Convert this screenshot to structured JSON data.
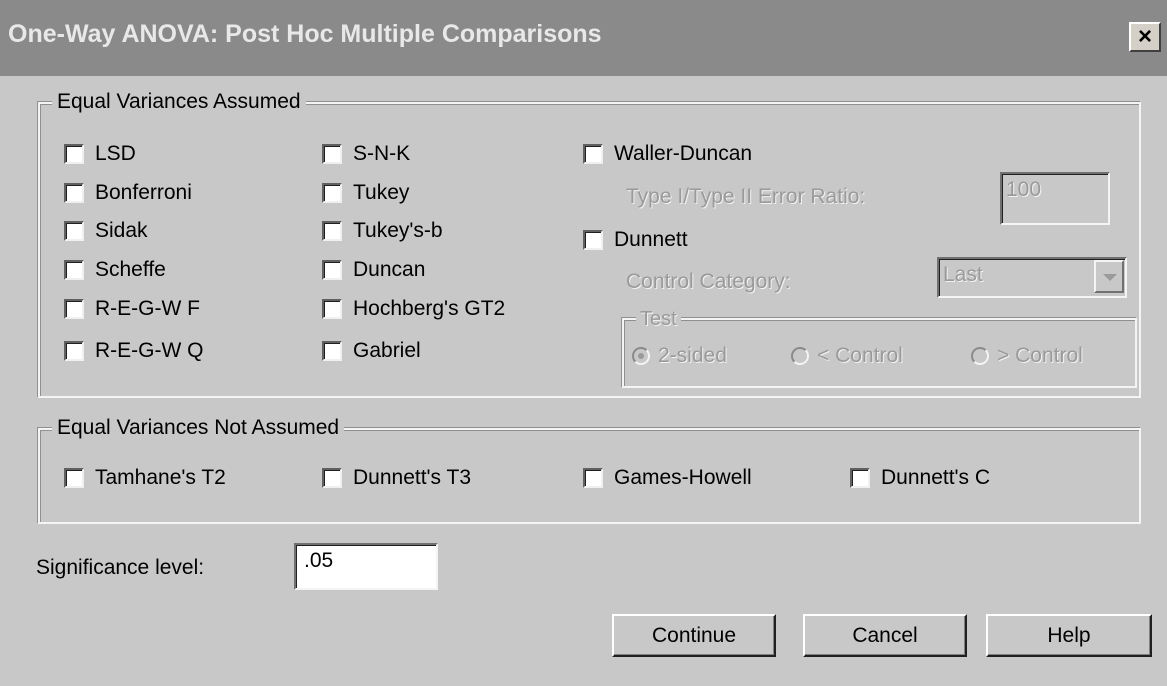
{
  "window": {
    "title": "One-Way ANOVA: Post Hoc Multiple Comparisons",
    "close_label": "×"
  },
  "equal_variances": {
    "title": "Equal Variances Assumed",
    "column1": [
      "LSD",
      "Bonferroni",
      "Sidak",
      "Scheffe",
      "R-E-G-W F",
      "R-E-G-W Q"
    ],
    "column2": [
      "S-N-K",
      "Tukey",
      "Tukey's-b",
      "Duncan",
      "Hochberg's GT2",
      "Gabriel"
    ],
    "waller": {
      "label": "Waller-Duncan",
      "ratio_label": "Type I/Type II Error Ratio:",
      "ratio_value": "100"
    },
    "dunnett": {
      "label": "Dunnett",
      "control_label": "Control Category:",
      "control_value": "Last",
      "test_title": "Test",
      "options": [
        "2-sided",
        "< Control",
        "> Control"
      ],
      "selected": "2-sided"
    }
  },
  "unequal_variances": {
    "title": "Equal Variances Not Assumed",
    "items": [
      "Tamhane's T2",
      "Dunnett's T3",
      "Games-Howell",
      "Dunnett's C"
    ]
  },
  "significance": {
    "label": "Significance level:",
    "value": ".05"
  },
  "buttons": {
    "continue": "Continue",
    "cancel": "Cancel",
    "help": "Help"
  }
}
